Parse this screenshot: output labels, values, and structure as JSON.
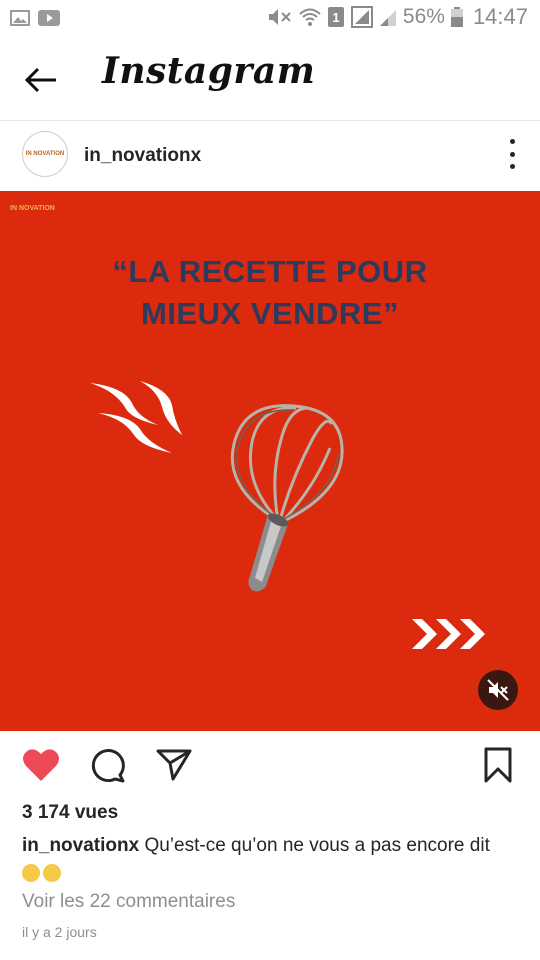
{
  "status_bar": {
    "battery": "56%",
    "time": "14:47",
    "sim": "1",
    "icons": [
      "gallery-icon",
      "youtube-icon",
      "mute-icon",
      "wifi-icon",
      "sim-icon",
      "signal-icon",
      "signal-weak-icon",
      "battery-icon"
    ]
  },
  "app_bar": {
    "title": "Instagram",
    "back_icon": "arrow-left-icon"
  },
  "post": {
    "username": "in_novationx",
    "headline_line1": "“LA RECETTE POUR",
    "headline_line2": "MIEUX VENDRE”",
    "image_logo": "IN NOVATION",
    "avatar_text": "IN NOVATION",
    "media_icons": [
      "whisk-icon",
      "steam-icon",
      "chevrons-right-icon",
      "muted-speaker-icon"
    ],
    "colors": {
      "background": "#dc2a0e",
      "headline": "#2b3b5e",
      "like": "#ed4956"
    }
  },
  "actions": {
    "like_icon": "heart-icon",
    "comment_icon": "comment-icon",
    "share_icon": "send-icon",
    "save_icon": "bookmark-icon"
  },
  "footer": {
    "views": "3 174 vues",
    "caption_user": "in_novationx",
    "caption_text": " Qu’est-ce qu’on ne vous a pas encore dit",
    "emojis": [
      "flushed-face-emoji",
      "sneezing-face-emoji"
    ],
    "comments_link": "Voir les 22 commentaires",
    "time_ago": "il y a 2 jours"
  }
}
